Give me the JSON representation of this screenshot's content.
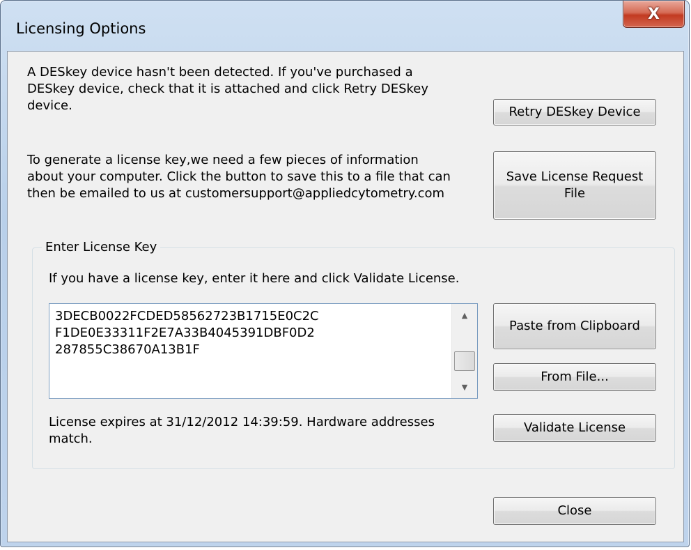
{
  "window": {
    "title": "Licensing Options",
    "close_label": "X"
  },
  "deskey": {
    "message": "A DESkey device hasn't been detected. If you've purchased a\nDESkey device, check that it is attached and click Retry DESkey\ndevice.",
    "retry_label": "Retry DESkey Device"
  },
  "request": {
    "message": "To generate a license key,we need a few pieces of information\nabout your computer. Click the button to save this to a file that can\nthen be emailed to us at customersupport@appliedcytometry.com",
    "save_label": "Save License Request\nFile"
  },
  "license_group": {
    "legend": "Enter License Key",
    "instruction": "If you have a license key, enter it here and click Validate License.",
    "key_value": "3DECB0022FCDED58562723B1715E0C2C\nF1DE0E33311F2E7A33B4045391DBF0D2\n287855C38670A13B1F",
    "paste_label": "Paste from Clipboard",
    "from_file_label": "From File...",
    "status": "License expires at 31/12/2012 14:39:59. Hardware addresses\nmatch.",
    "validate_label": "Validate License"
  },
  "footer": {
    "close_label": "Close"
  }
}
